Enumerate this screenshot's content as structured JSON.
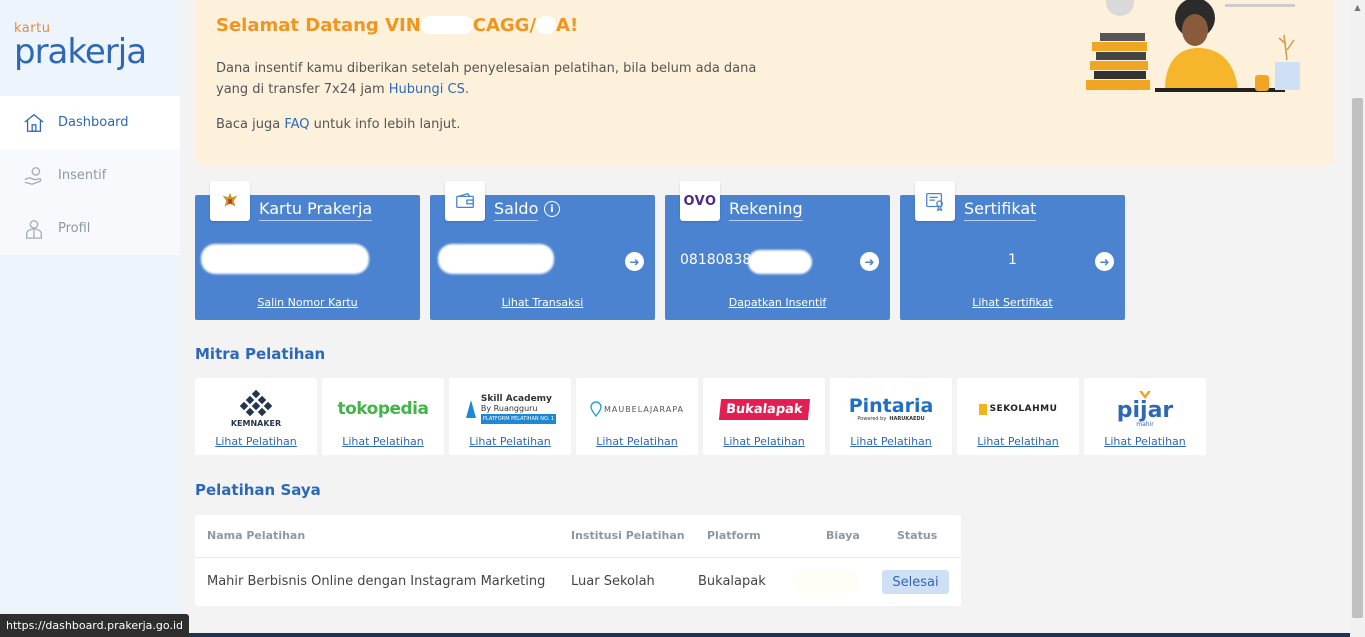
{
  "sidebar": {
    "logo_small": "kartu",
    "logo_main_a": "prakerja",
    "items": [
      {
        "label": "Dashboard",
        "icon": "home-icon",
        "active": true
      },
      {
        "label": "Insentif",
        "icon": "hand-coin-icon",
        "active": false
      },
      {
        "label": "Profil",
        "icon": "user-icon",
        "active": false
      }
    ]
  },
  "welcome": {
    "title_pre": "Selamat Datang VIN",
    "title_mid": "CA",
    "title_mid2": "GG/",
    "title_end": "A!",
    "p1_text": "Dana insentif kamu diberikan setelah penyelesaian pelatihan, bila belum ada dana yang di transfer 7x24 jam ",
    "p1_link": "Hubungi CS",
    "p1_end": ".",
    "p2_pre": "Baca juga ",
    "p2_link": "FAQ",
    "p2_post": " untuk info lebih lanjut."
  },
  "cards": [
    {
      "title": "Kartu Prakerja",
      "value": "",
      "link": "Salin Nomor Kartu",
      "icon": "garuda-icon"
    },
    {
      "title": "Saldo",
      "value": "",
      "link": "Lihat Transaksi",
      "icon": "wallet-icon"
    },
    {
      "title": "Rekening",
      "value": "08180838",
      "link": "Dapatkan Insentif",
      "icon": "ovo-logo",
      "icon_text": "OVO"
    },
    {
      "title": "Sertifikat",
      "value": "1",
      "link": "Lihat Sertifikat",
      "icon": "certificate-icon"
    }
  ],
  "mitra": {
    "title": "Mitra Pelatihan",
    "link_label": "Lihat Pelatihan",
    "partners": [
      {
        "name": "KEMNAKER"
      },
      {
        "name": "tokopedia"
      },
      {
        "name": "Skill Academy",
        "sub": "By Ruangguru",
        "sub2": "PLATFORM PELATIHAN NO. 1"
      },
      {
        "name": "MAUBELAJARAPA"
      },
      {
        "name": "Bukalapak"
      },
      {
        "name": "Pintaria",
        "sub": "Powered by",
        "sub2": "HARUKAEDU"
      },
      {
        "name": "SEKOLAHMU"
      },
      {
        "name": "pijar",
        "sub": "mahir"
      }
    ]
  },
  "pelatihan": {
    "title": "Pelatihan Saya",
    "headers": [
      "Nama Pelatihan",
      "Institusi Pelatihan",
      "Platform",
      "Biaya",
      "Status"
    ],
    "rows": [
      {
        "nama": "Mahir Berbisnis Online dengan Instagram Marketing",
        "institusi": "Luar Sekolah",
        "platform": "Bukalapak",
        "biaya": "",
        "status": "Selesai"
      }
    ]
  },
  "status_url": "https://dashboard.prakerja.go.id",
  "colors": {
    "primary": "#4b83d0",
    "accent": "#f0951f",
    "banner": "#fdf1dc"
  }
}
